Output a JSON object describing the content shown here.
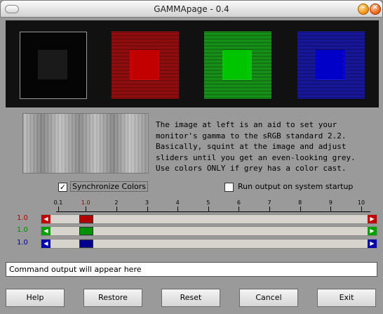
{
  "window": {
    "title": "GAMMApage - 0.4",
    "minimize_glyph": "–",
    "close_glyph": "×"
  },
  "swatches": [
    {
      "name": "black"
    },
    {
      "name": "red",
      "color": "#c20000"
    },
    {
      "name": "green",
      "color": "#00c400"
    },
    {
      "name": "blue",
      "color": "#0000c8"
    }
  ],
  "description": "The image at left is an aid to set your\nmonitor's gamma to the sRGB standard 2.2.\nBasically, squint at the image and adjust\nsliders until you get an even-looking grey.\nUse colors ONLY if grey has a color cast.",
  "options": {
    "synchronize_colors": {
      "label": "Synchronize Colors",
      "checked": true
    },
    "run_on_startup": {
      "label": "Run output on system startup",
      "checked": false
    }
  },
  "scale": {
    "ticks": [
      "0.1",
      "1.0",
      "2",
      "3",
      "4",
      "5",
      "6",
      "7",
      "8",
      "9",
      "10"
    ],
    "marker_value": "1.0"
  },
  "sliders": [
    {
      "channel": "red",
      "value": "1.0",
      "color": "#b00000",
      "arrow_color": "#c00000"
    },
    {
      "channel": "green",
      "value": "1.0",
      "color": "#009000",
      "arrow_color": "#00a000"
    },
    {
      "channel": "blue",
      "value": "1.0",
      "color": "#000090",
      "arrow_color": "#0000a8"
    }
  ],
  "output": {
    "text": "Command output will appear here"
  },
  "buttons": {
    "help": "Help",
    "restore": "Restore",
    "reset": "Reset",
    "cancel": "Cancel",
    "exit": "Exit"
  }
}
